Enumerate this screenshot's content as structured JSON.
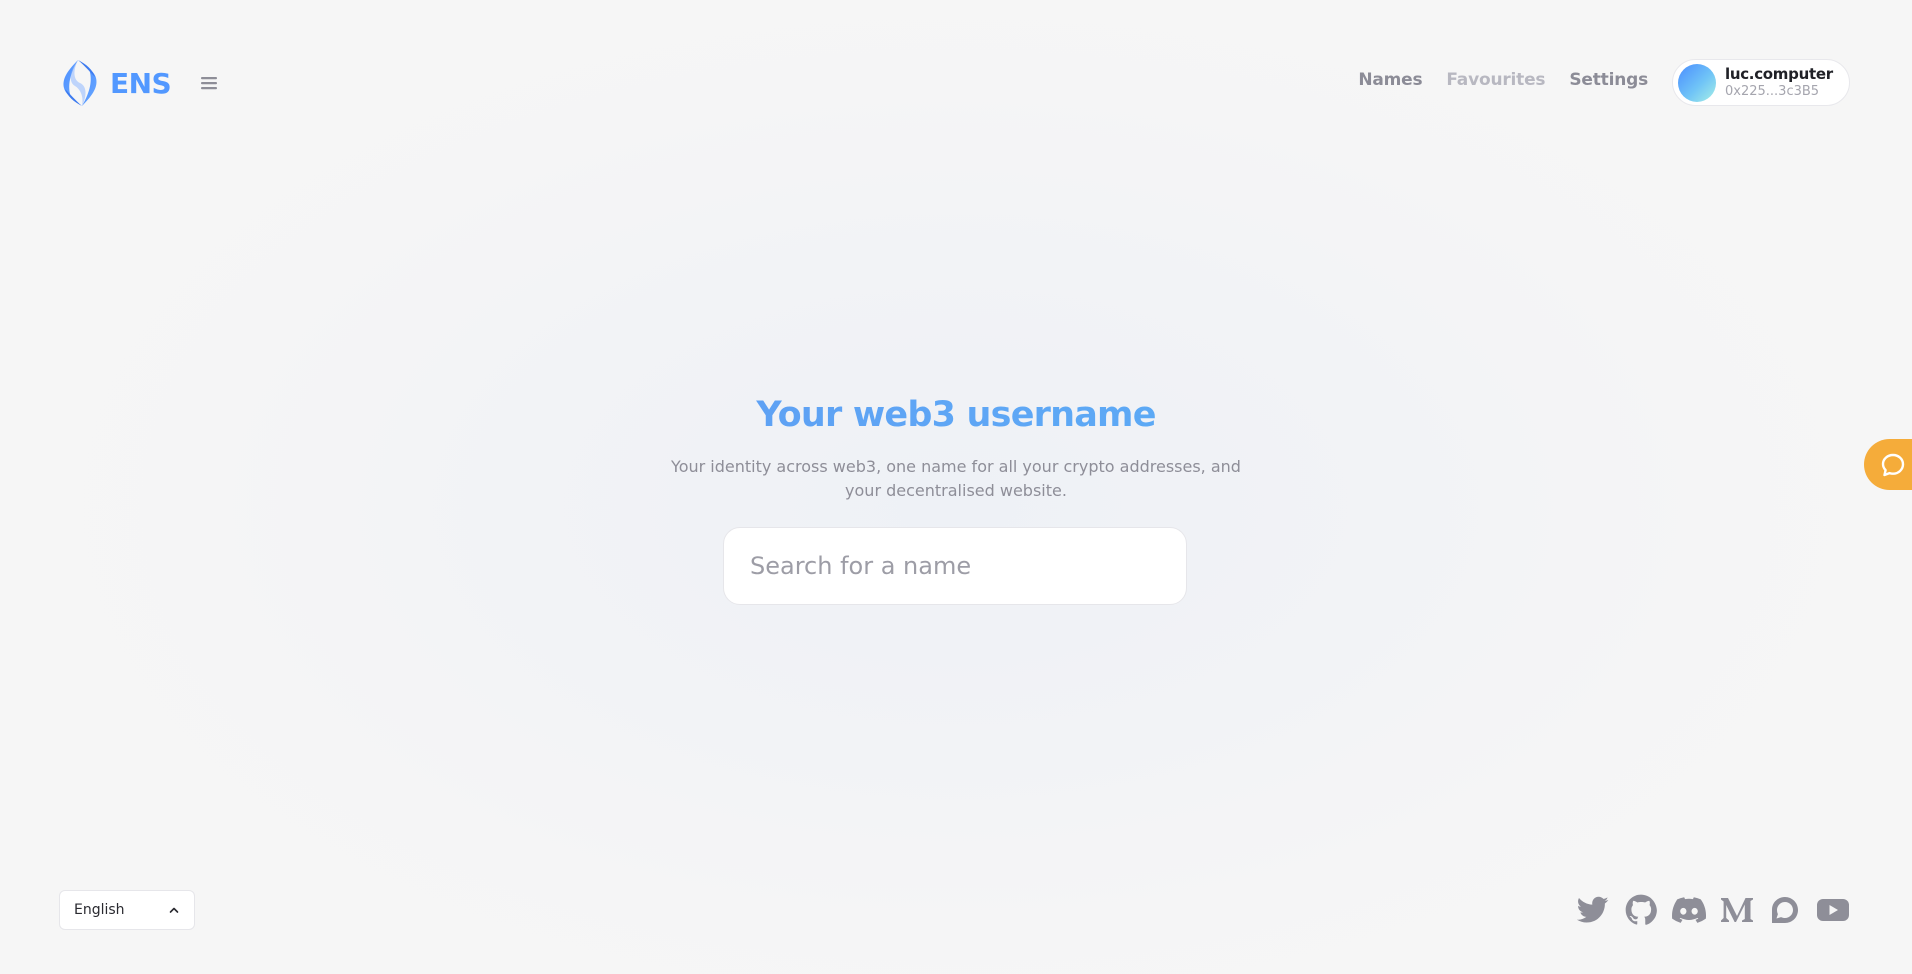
{
  "brand": {
    "name": "ENS",
    "logo_icon": "ens-logo-icon",
    "color": "#5298ff"
  },
  "header": {
    "menu_icon": "hamburger-menu-icon",
    "nav": [
      {
        "label": "Names",
        "state": "default"
      },
      {
        "label": "Favourites",
        "state": "muted"
      },
      {
        "label": "Settings",
        "state": "default"
      }
    ],
    "account": {
      "name": "luc.computer",
      "address": "0x225...3c3B5",
      "avatar_gradient": [
        "#4a8dff",
        "#6fc3f7",
        "#a7f0e6"
      ]
    }
  },
  "hero": {
    "title": "Your web3 username",
    "subtitle": "Your identity across web3, one name for all your crypto addresses, and your decentralised website.",
    "title_gradient": [
      "#5d8ff0",
      "#56b4f6"
    ]
  },
  "search": {
    "placeholder": "Search for a name",
    "value": ""
  },
  "feedback": {
    "icon": "chat-bubble-icon",
    "color": "#f5ac3a"
  },
  "footer": {
    "language": {
      "selected": "English",
      "icon": "chevron-up-icon"
    },
    "socials": [
      {
        "name": "twitter-icon"
      },
      {
        "name": "github-icon"
      },
      {
        "name": "discord-icon"
      },
      {
        "name": "medium-icon"
      },
      {
        "name": "discourse-icon"
      },
      {
        "name": "youtube-icon"
      }
    ],
    "icon_color": "#8e8e98"
  }
}
